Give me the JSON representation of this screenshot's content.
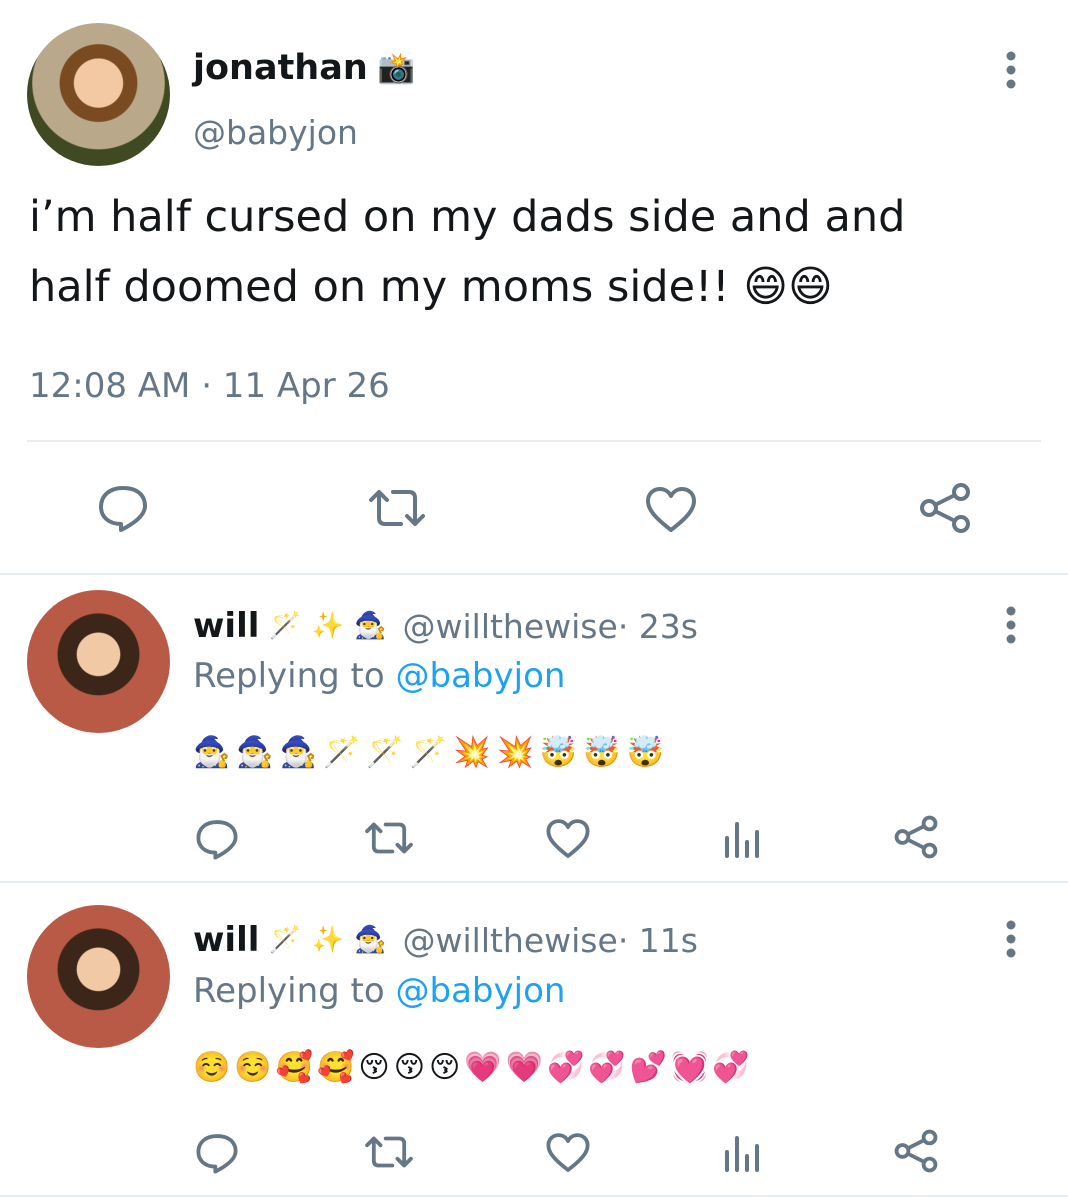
{
  "main_tweet": {
    "display_name": "jonathan",
    "name_badge": "📸",
    "handle": "@babyjon",
    "text_line1": "i’m half cursed on my dads side and and",
    "text_line2": "half doomed on my moms side!! 😄😄",
    "timestamp": "12:08 AM · 11 Apr 26"
  },
  "replies": [
    {
      "display_name": "will",
      "name_badges": "🪄✨🧙‍♂️",
      "handle": "@willthewise",
      "time": " · 23s",
      "replying_prefix": "Replying to ",
      "replying_to": "@babyjon",
      "body": "🧙‍♂️🧙‍♂️🧙‍♂️🪄🪄🪄💥💥🤯🤯🤯"
    },
    {
      "display_name": "will",
      "name_badges": "🪄✨🧙‍♂️",
      "handle": "@willthewise",
      "time": " · 11s",
      "replying_prefix": "Replying to ",
      "replying_to": "@babyjon",
      "body": "☺️☺️🥰🥰😚😚😚💗💗💞💞💕💓💞"
    }
  ],
  "colors": {
    "text": "#14171a",
    "secondary": "#657786",
    "link": "#1da1f2",
    "divider": "#e6ecf0"
  },
  "icons": [
    "reply-icon",
    "retweet-icon",
    "like-icon",
    "share-icon",
    "analytics-icon",
    "more-icon"
  ]
}
